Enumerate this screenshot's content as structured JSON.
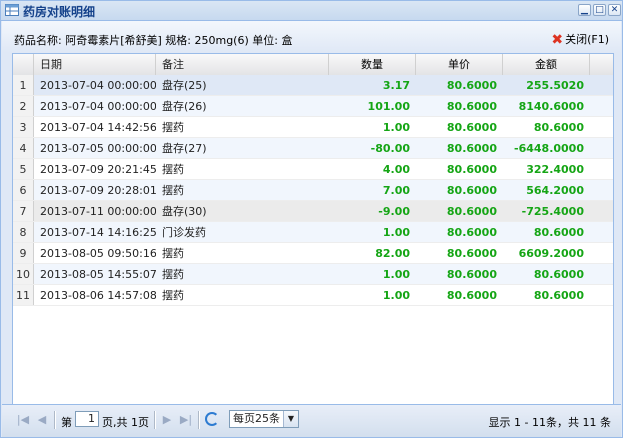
{
  "window": {
    "title": "药房对账明细",
    "tools": [
      "▁",
      "□",
      "✕"
    ]
  },
  "info": {
    "text": "药品名称: 阿奇霉素片[希舒美] 规格: 250mg(6) 单位: 盒",
    "close_label": "关闭(F1)"
  },
  "grid": {
    "columns": [
      "",
      "日期",
      "备注",
      "数量",
      "单价",
      "金额"
    ],
    "rows": [
      [
        "1",
        "2013-07-04 00:00:00",
        "盘存(25)",
        "3.17",
        "80.6000",
        "255.5020"
      ],
      [
        "2",
        "2013-07-04 00:00:00",
        "盘存(26)",
        "101.00",
        "80.6000",
        "8140.6000"
      ],
      [
        "3",
        "2013-07-04 14:42:56",
        "摆药",
        "1.00",
        "80.6000",
        "80.6000"
      ],
      [
        "4",
        "2013-07-05 00:00:00",
        "盘存(27)",
        "-80.00",
        "80.6000",
        "-6448.0000"
      ],
      [
        "5",
        "2013-07-09 20:21:45",
        "摆药",
        "4.00",
        "80.6000",
        "322.4000"
      ],
      [
        "6",
        "2013-07-09 20:28:01",
        "摆药",
        "7.00",
        "80.6000",
        "564.2000"
      ],
      [
        "7",
        "2013-07-11 00:00:00",
        "盘存(30)",
        "-9.00",
        "80.6000",
        "-725.4000"
      ],
      [
        "8",
        "2013-07-14 14:16:25",
        "门诊发药",
        "1.00",
        "80.6000",
        "80.6000"
      ],
      [
        "9",
        "2013-08-05 09:50:16",
        "摆药",
        "82.00",
        "80.6000",
        "6609.2000"
      ],
      [
        "10",
        "2013-08-05 14:55:07",
        "摆药",
        "1.00",
        "80.6000",
        "80.6000"
      ],
      [
        "11",
        "2013-08-06 14:57:08",
        "摆药",
        "1.00",
        "80.6000",
        "80.6000"
      ]
    ],
    "row_styles": [
      "sel",
      "alt",
      "",
      "alt",
      "",
      "alt",
      "gray",
      "alt",
      "",
      "alt",
      ""
    ]
  },
  "pager": {
    "page_prefix": "第",
    "page_value": "1",
    "page_suffix": "页,共 1页",
    "per_page": "每页25条",
    "display": "显示 1 - 11条，共 11 条"
  }
}
